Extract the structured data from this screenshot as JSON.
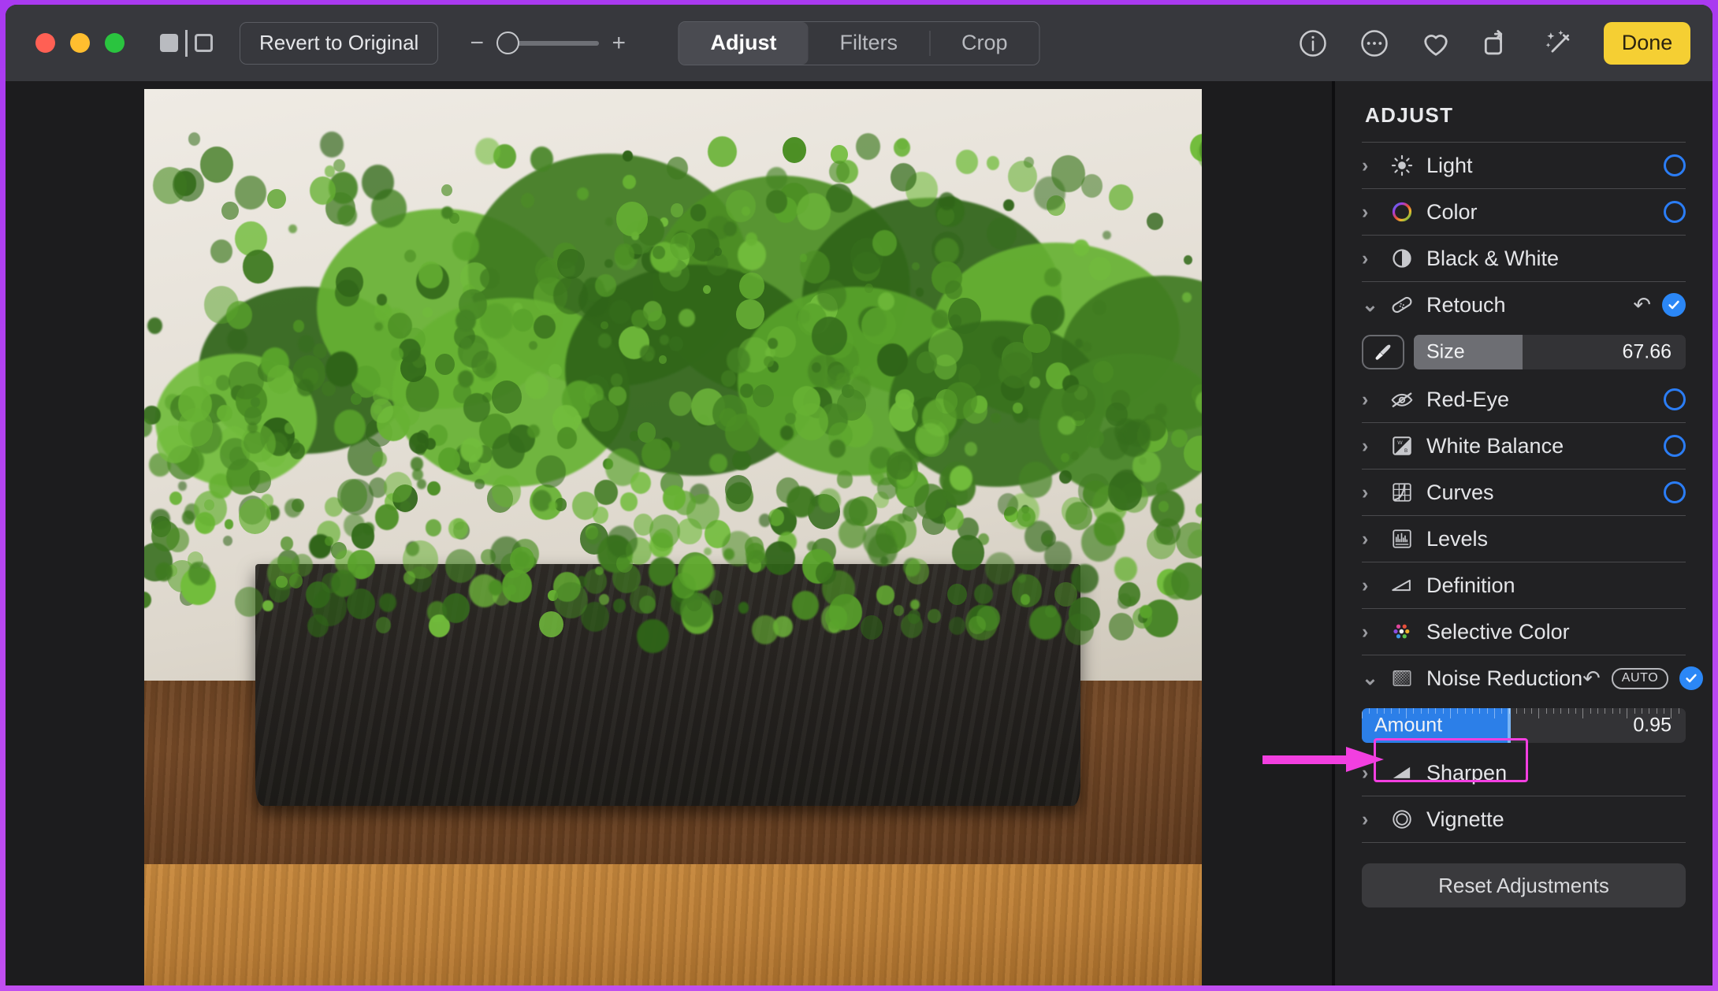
{
  "window": {
    "accent_purple": "#b44bf0",
    "titlebar_bg": "#37383d",
    "sidebar_bg": "#212123"
  },
  "titlebar": {
    "traffic_lights": [
      "close",
      "minimize",
      "zoom"
    ],
    "compare_toggle": "before-after-compare",
    "revert_label": "Revert to Original",
    "zoom": {
      "minus": "−",
      "plus": "+",
      "knob_position_pct": 0
    },
    "segments": [
      {
        "label": "Adjust",
        "active": true
      },
      {
        "label": "Filters",
        "active": false
      },
      {
        "label": "Crop",
        "active": false
      }
    ],
    "icons": [
      "info-icon",
      "ellipsis-icon",
      "heart-icon",
      "rotate-icon",
      "magic-wand-icon"
    ],
    "done_label": "Done",
    "done_color": "#f5cf33"
  },
  "photo": {
    "subject": "preserved green moss in a dark rectangular planter on a wooden table"
  },
  "sidebar": {
    "title": "ADJUST",
    "reset_label": "Reset Adjustments",
    "items": [
      {
        "label": "Light",
        "icon": "sun-icon",
        "expanded": false,
        "toggle": "ring"
      },
      {
        "label": "Color",
        "icon": "color-wheel-icon",
        "expanded": false,
        "toggle": "ring"
      },
      {
        "label": "Black & White",
        "icon": "contrast-circle-icon",
        "expanded": false,
        "toggle": "none"
      },
      {
        "label": "Retouch",
        "icon": "bandage-icon",
        "expanded": true,
        "toggle": "check",
        "revert": true
      },
      {
        "label": "Red-Eye",
        "icon": "eye-slash-icon",
        "expanded": false,
        "toggle": "ring"
      },
      {
        "label": "White Balance",
        "icon": "white-balance-icon",
        "expanded": false,
        "toggle": "ring"
      },
      {
        "label": "Curves",
        "icon": "curves-icon",
        "expanded": false,
        "toggle": "ring"
      },
      {
        "label": "Levels",
        "icon": "levels-icon",
        "expanded": false,
        "toggle": "none"
      },
      {
        "label": "Definition",
        "icon": "definition-icon",
        "expanded": false,
        "toggle": "none"
      },
      {
        "label": "Selective Color",
        "icon": "selective-color-icon",
        "expanded": false,
        "toggle": "none"
      },
      {
        "label": "Noise Reduction",
        "icon": "noise-icon",
        "expanded": true,
        "toggle": "check",
        "revert": true,
        "auto_badge": "AUTO"
      },
      {
        "label": "Sharpen",
        "icon": "sharpen-icon",
        "expanded": false,
        "toggle": "none"
      },
      {
        "label": "Vignette",
        "icon": "vignette-icon",
        "expanded": false,
        "toggle": "none"
      }
    ],
    "retouch_slider": {
      "label": "Size",
      "value": "67.66",
      "fill_pct": 40,
      "style": "gray",
      "brush_button": "brush-icon"
    },
    "noise_slider": {
      "label": "Amount",
      "value": "0.95",
      "fill_pct": 46,
      "style": "blue",
      "ticks": true
    }
  },
  "annotation": {
    "arrow_color": "#f23fe0",
    "points_at": "Amount"
  }
}
